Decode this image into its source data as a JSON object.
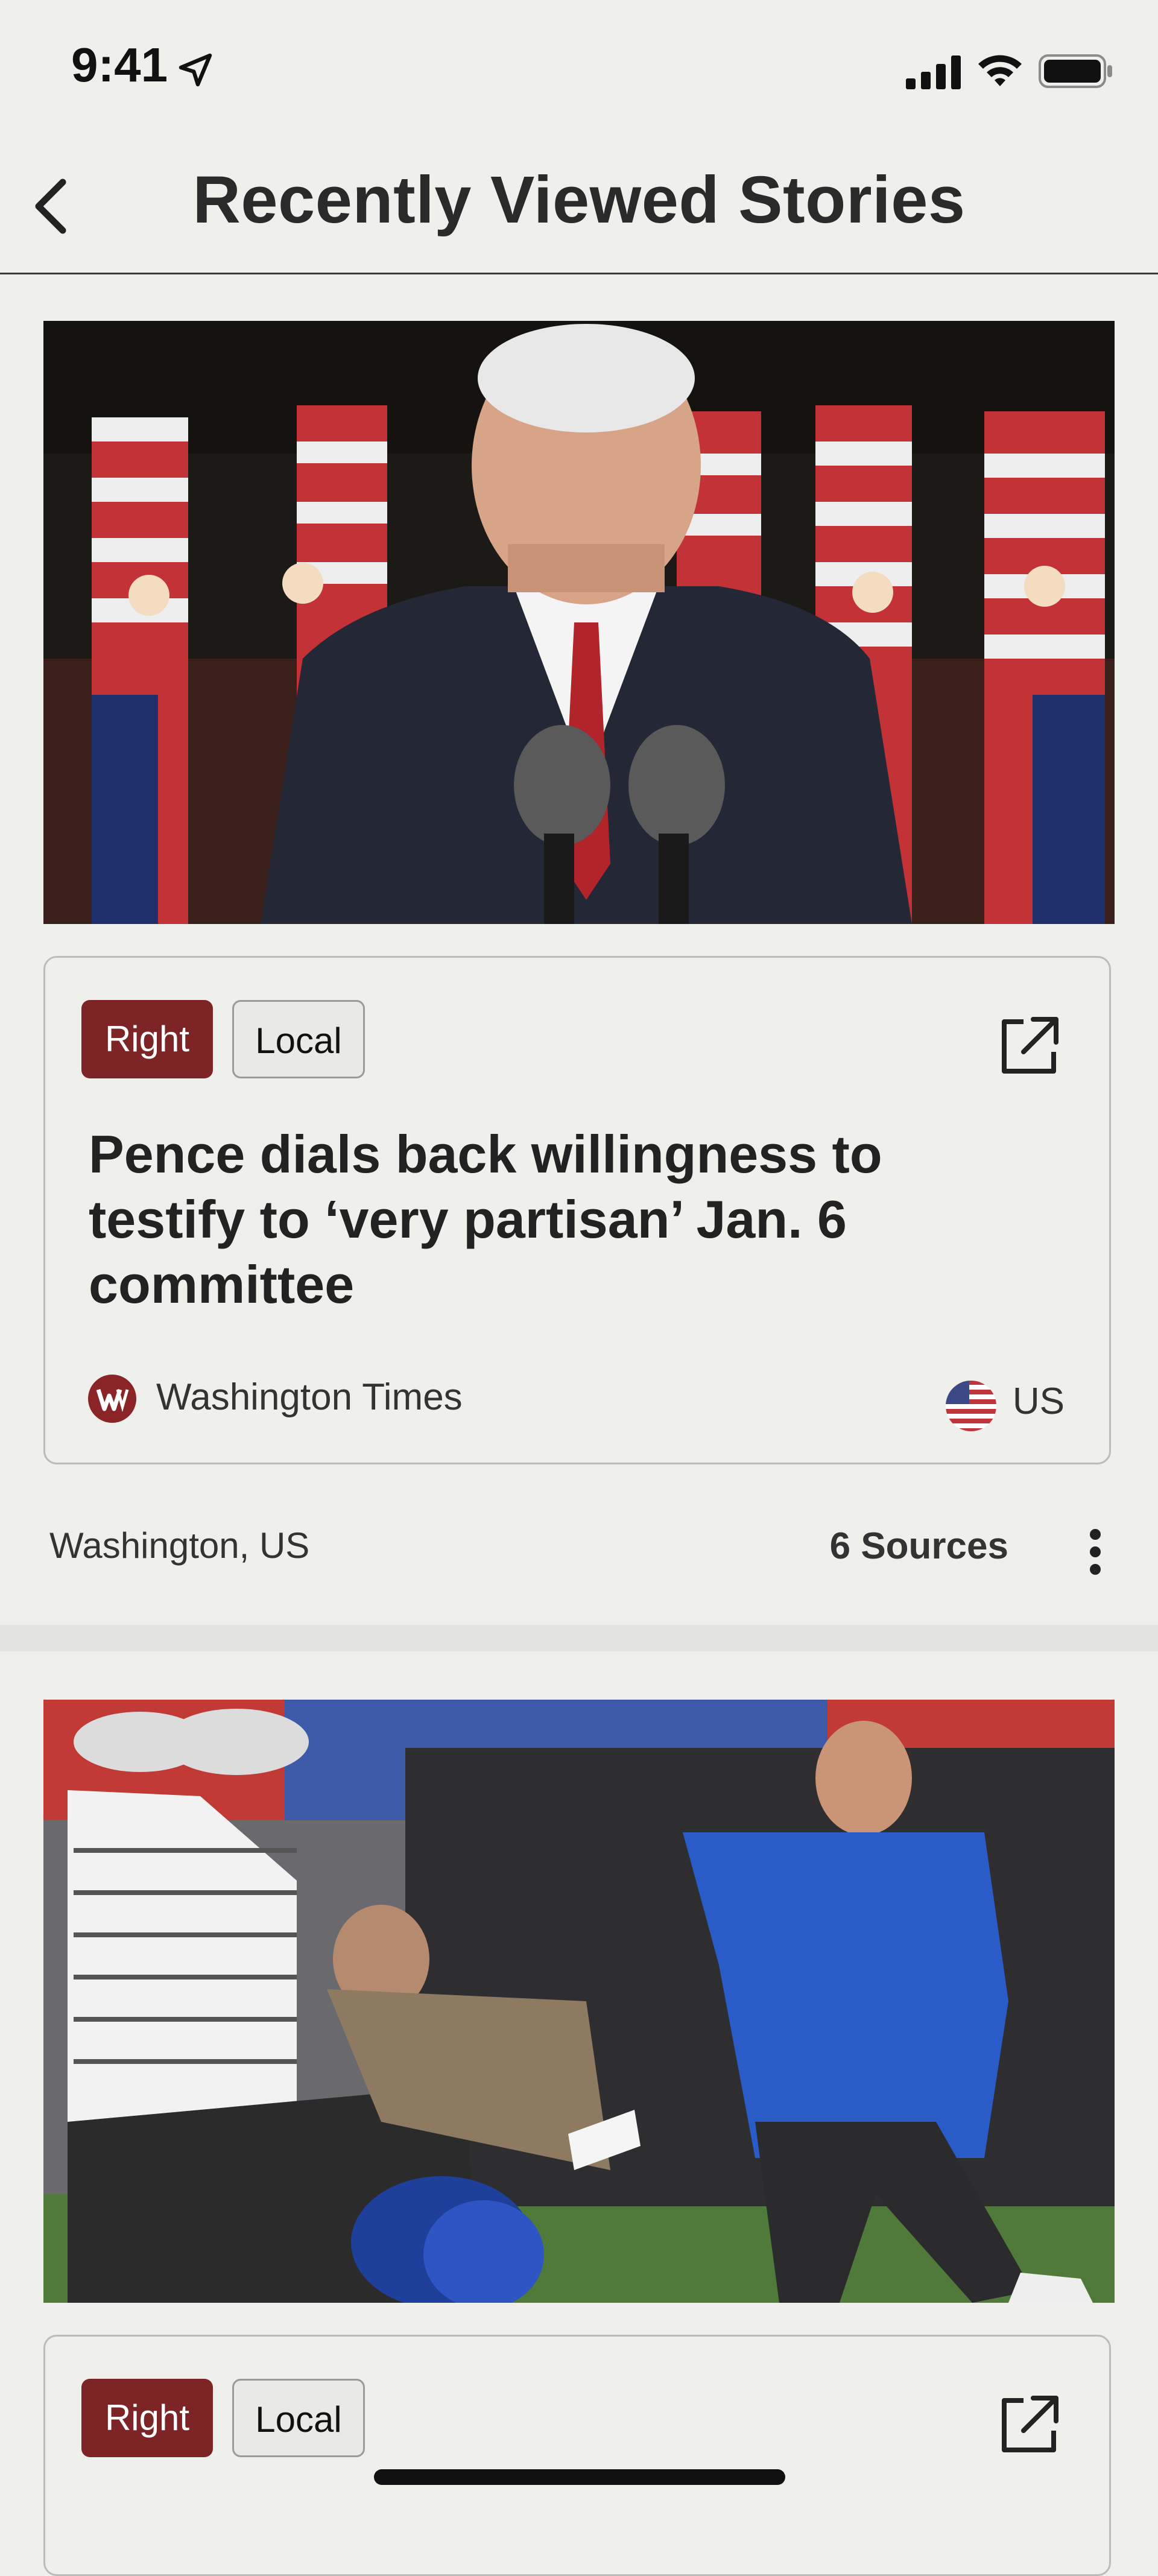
{
  "status_bar": {
    "time": "9:41"
  },
  "nav": {
    "title": "Recently Viewed Stories"
  },
  "stories": [
    {
      "bias_tag": "Right",
      "scope_tag": "Local",
      "headline": "Pence dials back willingness to testify to ‘very partisan’ Jan. 6 committee",
      "source_name": "Washington Times",
      "country": "US",
      "location": "Washington, US",
      "sources_count": "6 Sources"
    },
    {
      "bias_tag": "Right",
      "scope_tag": "Local"
    }
  ],
  "colors": {
    "bias_right": "#7c2426",
    "background": "#efefeb"
  }
}
